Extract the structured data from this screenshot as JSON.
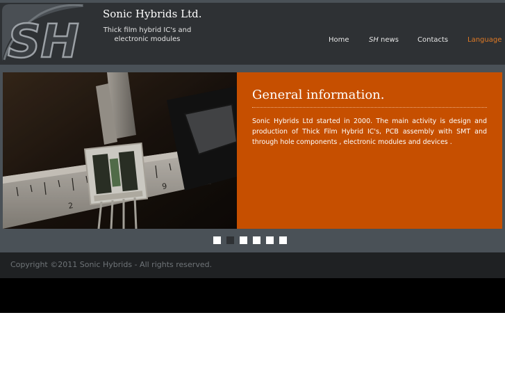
{
  "header": {
    "logo_text": "SH",
    "site_title": "Sonic Hybrids Ltd.",
    "tagline": "Thick film hybrid IC's and electronic modules"
  },
  "nav": {
    "items": [
      {
        "label": "Home"
      },
      {
        "label_prefix": "SH",
        "label": " news"
      },
      {
        "label": "Contacts"
      },
      {
        "label": "Language",
        "color": "#e07a25"
      }
    ]
  },
  "slider": {
    "heading": "General information.",
    "text": "Sonic Hybrids Ltd started in 2000. The main activity is design and production of Thick Film Hybrid IC's, PCB assembly with SMT and through hole components , electronic modules and devices .",
    "slide_count": 6,
    "active_slide": 2,
    "panel_color": "#c64f00"
  },
  "footer": {
    "copyright": "Copyright ©2011 Sonic Hybrids - All rights reserved."
  },
  "colors": {
    "header_bg": "#2e3134",
    "band_bg": "#4a5157",
    "footer_bg": "#1f2123",
    "accent": "#e07a25"
  }
}
